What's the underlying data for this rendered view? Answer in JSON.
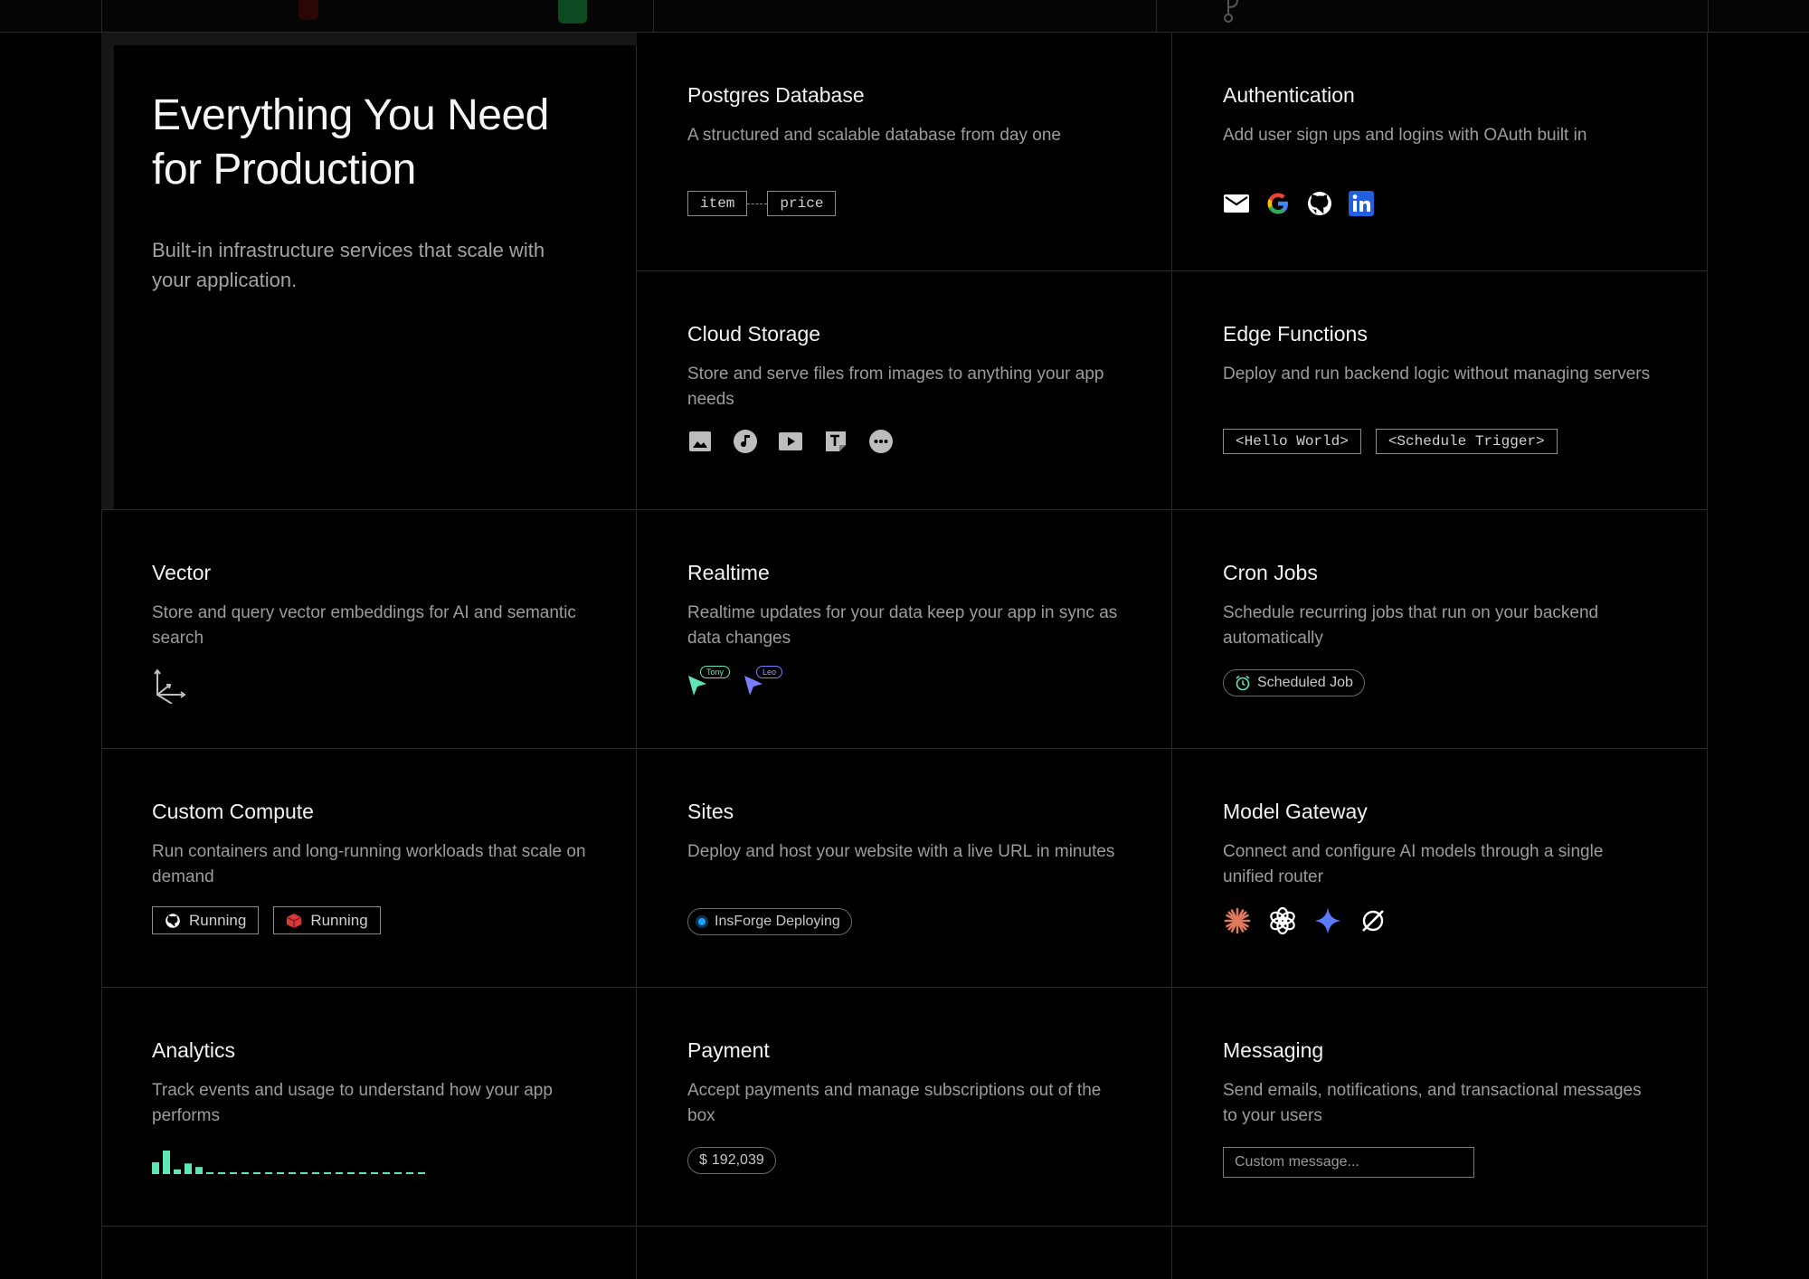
{
  "hero": {
    "title": "Everything You Need for Production",
    "subtitle": "Built-in infrastructure services that scale with your application."
  },
  "features": {
    "postgres": {
      "title": "Postgres Database",
      "desc": "A structured and scalable database from day one",
      "tags": [
        "item",
        "price"
      ]
    },
    "auth": {
      "title": "Authentication",
      "desc": "Add user sign ups and logins with OAuth built in",
      "icons": [
        "email-icon",
        "google-icon",
        "github-icon",
        "linkedin-icon"
      ]
    },
    "storage": {
      "title": "Cloud Storage",
      "desc": "Store and serve files from images to anything your app needs",
      "icons": [
        "image-icon",
        "music-icon",
        "video-icon",
        "text-file-icon",
        "more-icon"
      ]
    },
    "edge": {
      "title": "Edge Functions",
      "desc": "Deploy and run backend logic without managing servers",
      "tags": [
        "<Hello World>",
        "<Schedule Trigger>"
      ]
    },
    "vector": {
      "title": "Vector",
      "desc": "Store and query vector embeddings for AI and semantic search",
      "icon": "vector-axes-icon"
    },
    "realtime": {
      "title": "Realtime",
      "desc": "Realtime updates for your data keep your app in sync as data changes",
      "cursors": [
        "Tony",
        "Leo"
      ]
    },
    "cron": {
      "title": "Cron Jobs",
      "desc": "Schedule recurring jobs that run on your backend automatically",
      "badge": "Scheduled Job"
    },
    "compute": {
      "title": "Custom Compute",
      "desc": "Run containers and long-running workloads that scale on demand",
      "status": [
        "Running",
        "Running"
      ]
    },
    "sites": {
      "title": "Sites",
      "desc": "Deploy and host your website with a live URL in minutes",
      "badge": "InsForge Deploying"
    },
    "gateway": {
      "title": "Model Gateway",
      "desc": "Connect and configure AI models through a single unified router",
      "icons": [
        "anthropic-icon",
        "openai-icon",
        "gemini-icon",
        "grok-icon"
      ]
    },
    "analytics": {
      "title": "Analytics",
      "desc": "Track events and usage to understand how your app performs",
      "bars": [
        0.5,
        1.0,
        0.2,
        0.45,
        0.3
      ]
    },
    "payment": {
      "title": "Payment",
      "desc": "Accept payments and manage subscriptions out of the box",
      "currency": "$",
      "amount": "192,039"
    },
    "messaging": {
      "title": "Messaging",
      "desc": "Send emails, notifications, and transactional messages to your users",
      "placeholder": "Custom message..."
    }
  },
  "colors": {
    "accent_green": "#5ee6b5",
    "accent_purple": "#7b7bff",
    "line": "#2a2a2a",
    "anthropic": "#e07a5f",
    "gemini": "#5b7cff"
  }
}
